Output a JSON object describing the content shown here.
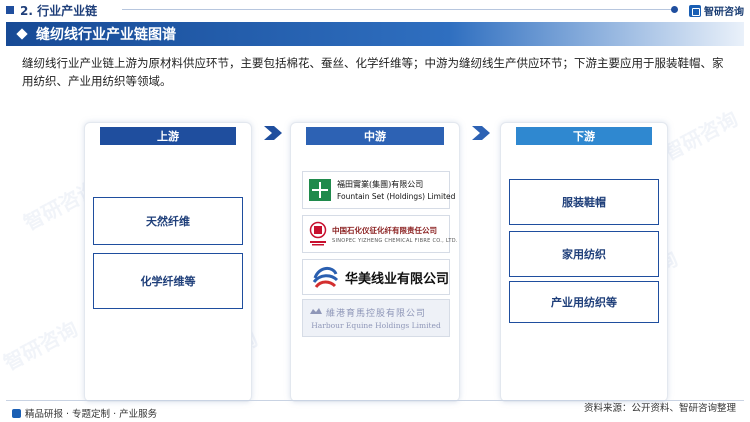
{
  "header": {
    "section_title": "2. 行业产业链",
    "brand_name": "智研咨询"
  },
  "banner": {
    "title": "缝纫线行业产业链图谱"
  },
  "description": "缝纫线行业产业链上游为原材料供应环节，主要包括棉花、蚕丝、化学纤维等；中游为缝纫线生产供应环节；下游主要应用于服装鞋帽、家用纺织、产业用纺织等领域。",
  "upstream": {
    "header": "上游",
    "items": [
      "天然纤维",
      "化学纤维等"
    ]
  },
  "midstream": {
    "header": "中游",
    "logos": [
      {
        "cn": "福田實業(集團)有限公司",
        "en": "Fountain Set (Holdings) Limited"
      },
      {
        "cn": "中国石化仪征化纤有限责任公司",
        "en": "SINOPEC YIZHENG CHEMICAL FIBRE CO., LTD.",
        "mark_text": "中国石化 SINOPEC"
      },
      {
        "cn": "华美线业有限公司"
      },
      {
        "cn": "維港育馬控股有限公司",
        "en": "Harbour Equine Holdings Limited"
      }
    ]
  },
  "downstream": {
    "header": "下游",
    "items": [
      "服装鞋帽",
      "家用纺织",
      "产业用纺织等"
    ]
  },
  "watermark": "智研咨询",
  "footer": {
    "left": "精品研报 · 专题定制 · 产业服务",
    "source": "资料来源：公开资料、智研咨询整理"
  },
  "colors": {
    "primary": "#1f4e9e",
    "mid": "#2d62b4",
    "down": "#2f88d0"
  }
}
